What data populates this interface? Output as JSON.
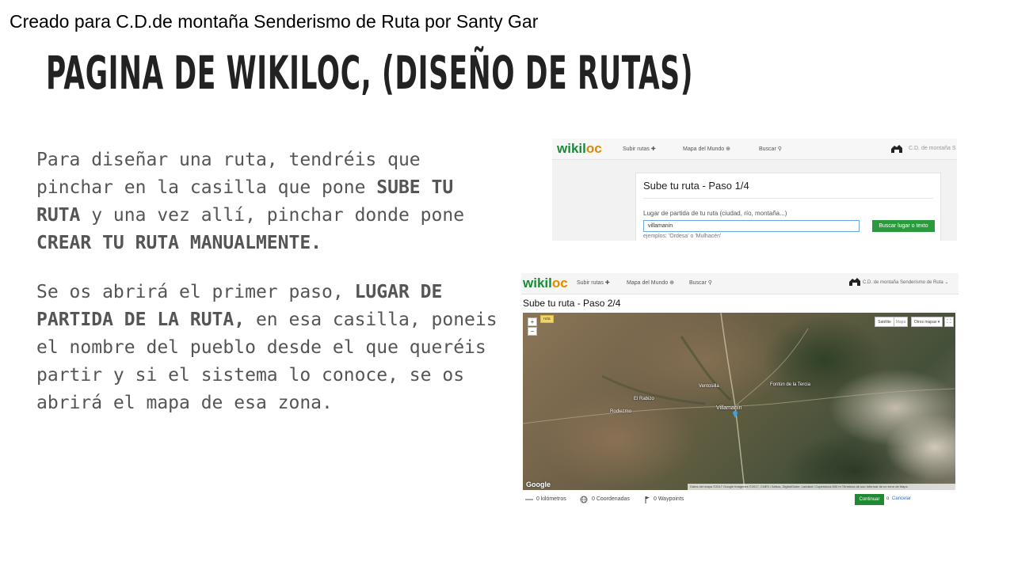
{
  "header": {
    "credit": "Creado para C.D.de montaña Senderismo de Ruta por Santy Gar",
    "title": "PAGINA DE WIKILOC, (DISEÑO DE RUTAS)"
  },
  "para1": {
    "t1": "Para diseñar una ruta, tendréis que pinchar en la casilla que pone ",
    "b1": "SUBE TU RUTA",
    "t2": " y una vez allí, pinchar donde pone ",
    "b2": "CREAR TU RUTA MANUALMENTE."
  },
  "para2": {
    "t1": "Se os abrirá el primer paso, ",
    "b1": "LUGAR DE PARTIDA DE LA RUTA,",
    "t2": " en esa casilla, poneis el nombre del pueblo desde el que queréis partir y si el sistema lo conoce, se os abrirá el mapa de esa zona."
  },
  "shot1": {
    "logo": {
      "w": "wikil",
      "oo": "oc"
    },
    "nav": [
      "Subir rutas ✚",
      "Mapa del Mundo ⊕",
      "Buscar ⚲"
    ],
    "user": "C.D. de montaña S",
    "card_title": "Sube tu ruta - Paso 1/4",
    "label": "Lugar de partida de tu ruta (ciudad, río, montaña...)",
    "input_value": "villamanin",
    "button": "Buscar lugar o texto",
    "hint": "ejemplos: 'Ordesa' o 'Mulhacén'"
  },
  "shot2": {
    "logo": {
      "w": "wikil",
      "oo": "oc"
    },
    "nav": [
      "Subir rutas ✚",
      "Mapa del Mundo ⊕",
      "Buscar ⚲"
    ],
    "user": "C.D. de montaña Senderismo de Ruta ⌄",
    "heading": "Sube tu ruta - Paso 2/4",
    "map": {
      "zoom_in": "+",
      "zoom_out": "−",
      "tag": "ruta",
      "type_satellite": "Satélite",
      "type_map": "Mapa",
      "other_maps": "Otros mapas ▾",
      "fullscreen": "⛶",
      "places": [
        "Villamanín",
        "Ventosilla",
        "El Rabizo",
        "Rodiezmo",
        "Fontún de la Tercia"
      ],
      "google": "Google",
      "footer": "Datos del mapa ©2017 Google Imágenes ©2017, CNES / Airbus, DigitalGlobe, Landsat / Copernicus   500 m   Términos de uso   Informar de un error de Maps"
    },
    "footer": {
      "km": "0 kilómetros",
      "coords": "0 Coordenadas",
      "waypoints": "0 Waypoints",
      "continue": "Continuar",
      "or": "o",
      "cancel": "Cancelar"
    }
  }
}
